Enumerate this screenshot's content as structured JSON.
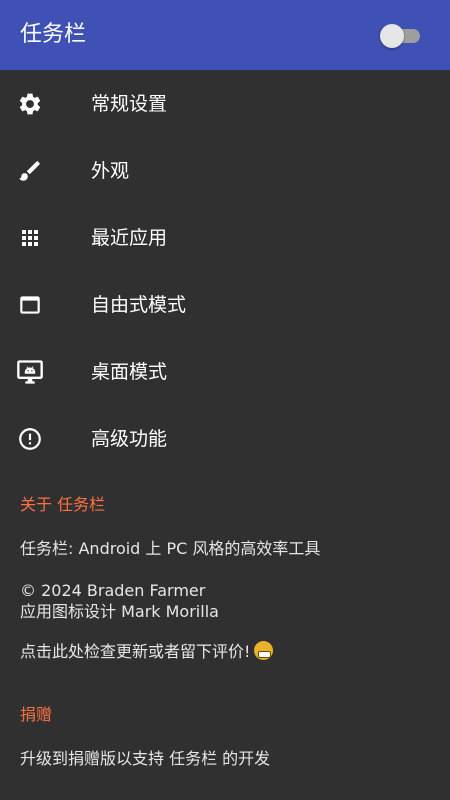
{
  "appbar": {
    "title": "任务栏",
    "toggle_on": false
  },
  "menu": [
    {
      "label": "常规设置",
      "icon": "gear-icon"
    },
    {
      "label": "外观",
      "icon": "brush-icon"
    },
    {
      "label": "最近应用",
      "icon": "grid-icon"
    },
    {
      "label": "自由式模式",
      "icon": "window-icon"
    },
    {
      "label": "桌面模式",
      "icon": "monitor-android-icon"
    },
    {
      "label": "高级功能",
      "icon": "alert-circle-icon"
    }
  ],
  "about": {
    "title": "关于 任务栏",
    "description": "任务栏: Android 上 PC 风格的高效率工具",
    "copyright": "© 2024 Braden Farmer",
    "icon_credit": "应用图标设计 Mark Morilla",
    "update_prompt": "点击此处检查更新或者留下评价!"
  },
  "donate": {
    "title": "捐赠",
    "description": "升级到捐赠版以支持 任务栏 的开发"
  },
  "colors": {
    "appbar": "#3f51b5",
    "background": "#303030",
    "accent": "#ff7043"
  }
}
